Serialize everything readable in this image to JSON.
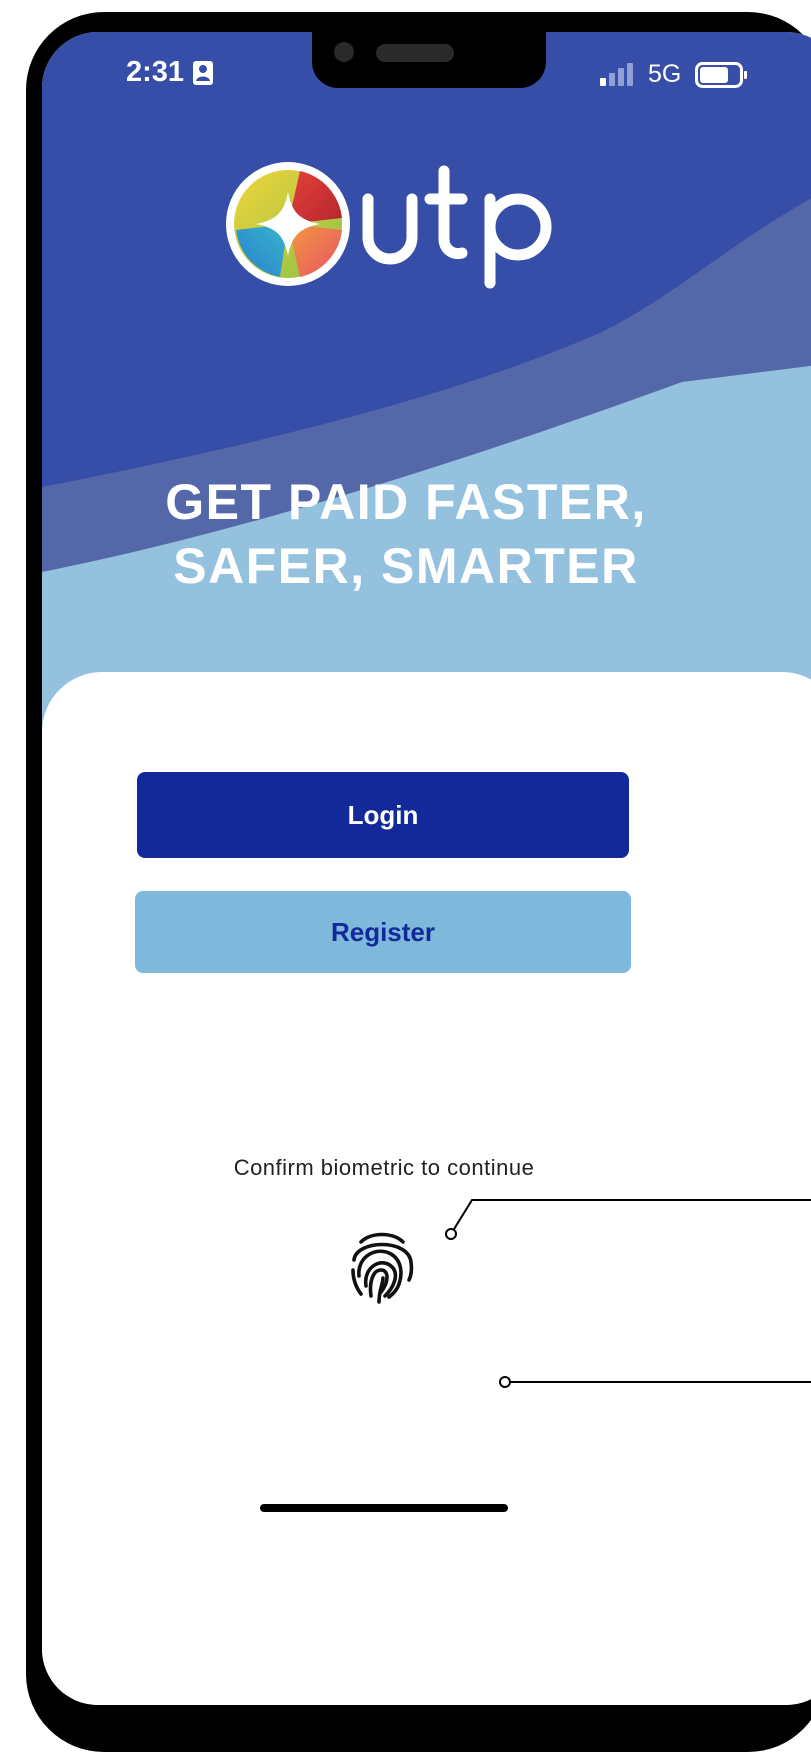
{
  "status_bar": {
    "time": "2:31",
    "network": "5G",
    "time_badge_icon": "person-id-icon",
    "signal_icon": "signal-bars-icon",
    "battery_icon": "battery-icon"
  },
  "brand": {
    "name": "utp",
    "primary_color": "#13299a",
    "header_color": "#364ea7",
    "accent_light": "#93c1de"
  },
  "headline": {
    "line1": "GET PAID FASTER,",
    "line2": "SAFER, SMARTER"
  },
  "actions": {
    "login_label": "Login",
    "register_label": "Register"
  },
  "biometric": {
    "prompt": "Confirm biometric to continue",
    "icon": "fingerprint-icon"
  }
}
